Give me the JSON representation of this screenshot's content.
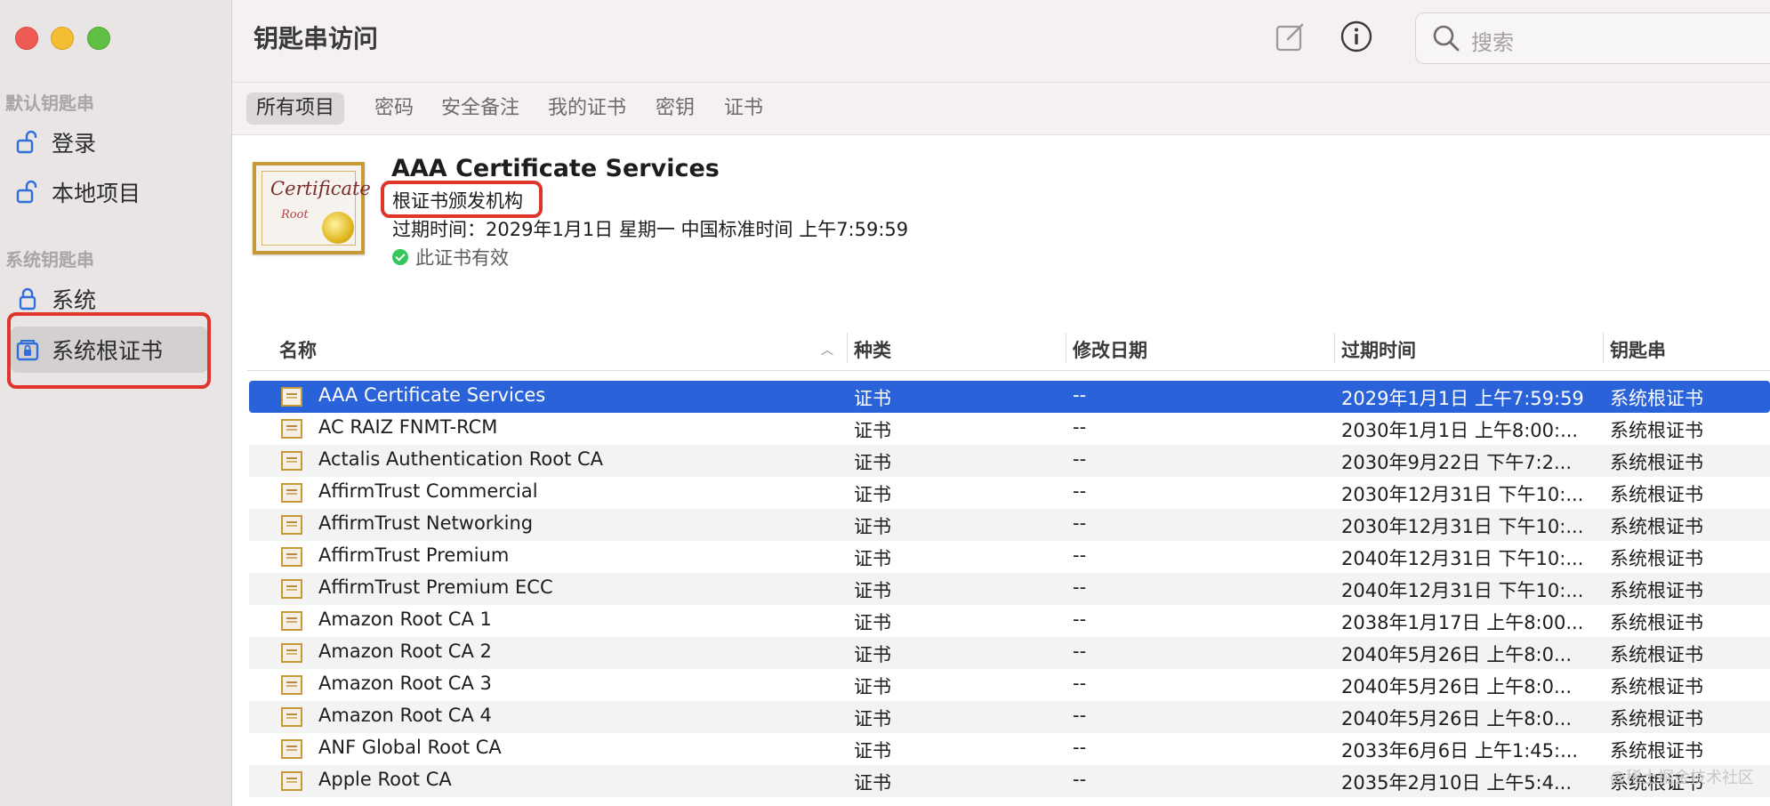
{
  "window": {
    "title": "钥匙串访问"
  },
  "search": {
    "placeholder": "搜索"
  },
  "sidebar": {
    "default_section": "默认钥匙串",
    "system_section": "系统钥匙串",
    "items": [
      {
        "label": "登录",
        "icon": "unlocked-lock-icon"
      },
      {
        "label": "本地项目",
        "icon": "unlocked-lock-icon"
      },
      {
        "label": "系统",
        "icon": "lock-icon"
      },
      {
        "label": "系统根证书",
        "icon": "locked-cabinet-icon",
        "selected": true
      }
    ]
  },
  "tabs": [
    "所有项目",
    "密码",
    "安全备注",
    "我的证书",
    "密钥",
    "证书"
  ],
  "detail": {
    "name": "AAA Certificate Services",
    "kind": "根证书颁发机构",
    "expiry": "过期时间：2029年1月1日 星期一 中国标准时间 上午7:59:59",
    "status": "此证书有效",
    "thumb_line1": "Certificate",
    "thumb_line2": "Root"
  },
  "table": {
    "columns": [
      "名称",
      "种类",
      "修改日期",
      "过期时间",
      "钥匙串"
    ],
    "rows": [
      {
        "name": "AAA Certificate Services",
        "kind": "证书",
        "modified": "--",
        "expires": "2029年1月1日 上午7:59:59",
        "keychain": "系统根证书",
        "selected": true
      },
      {
        "name": "AC RAIZ FNMT-RCM",
        "kind": "证书",
        "modified": "--",
        "expires": "2030年1月1日 上午8:00:...",
        "keychain": "系统根证书"
      },
      {
        "name": "Actalis Authentication Root CA",
        "kind": "证书",
        "modified": "--",
        "expires": "2030年9月22日 下午7:2...",
        "keychain": "系统根证书"
      },
      {
        "name": "AffirmTrust Commercial",
        "kind": "证书",
        "modified": "--",
        "expires": "2030年12月31日 下午10:...",
        "keychain": "系统根证书"
      },
      {
        "name": "AffirmTrust Networking",
        "kind": "证书",
        "modified": "--",
        "expires": "2030年12月31日 下午10:...",
        "keychain": "系统根证书"
      },
      {
        "name": "AffirmTrust Premium",
        "kind": "证书",
        "modified": "--",
        "expires": "2040年12月31日 下午10:...",
        "keychain": "系统根证书"
      },
      {
        "name": "AffirmTrust Premium ECC",
        "kind": "证书",
        "modified": "--",
        "expires": "2040年12月31日 下午10:...",
        "keychain": "系统根证书"
      },
      {
        "name": "Amazon Root CA 1",
        "kind": "证书",
        "modified": "--",
        "expires": "2038年1月17日 上午8:00...",
        "keychain": "系统根证书"
      },
      {
        "name": "Amazon Root CA 2",
        "kind": "证书",
        "modified": "--",
        "expires": "2040年5月26日 上午8:0...",
        "keychain": "系统根证书"
      },
      {
        "name": "Amazon Root CA 3",
        "kind": "证书",
        "modified": "--",
        "expires": "2040年5月26日 上午8:0...",
        "keychain": "系统根证书"
      },
      {
        "name": "Amazon Root CA 4",
        "kind": "证书",
        "modified": "--",
        "expires": "2040年5月26日 上午8:0...",
        "keychain": "系统根证书"
      },
      {
        "name": "ANF Global Root CA",
        "kind": "证书",
        "modified": "--",
        "expires": "2033年6月6日 上午1:45:...",
        "keychain": "系统根证书"
      },
      {
        "name": "Apple Root CA",
        "kind": "证书",
        "modified": "--",
        "expires": "2035年2月10日 上午5:4...",
        "keychain": "系统根证书"
      }
    ]
  },
  "watermark": "@稀土掘金技术社区",
  "colors": {
    "selection": "#2a62d9",
    "highlight_box": "#e0352b",
    "valid": "#34c759"
  }
}
